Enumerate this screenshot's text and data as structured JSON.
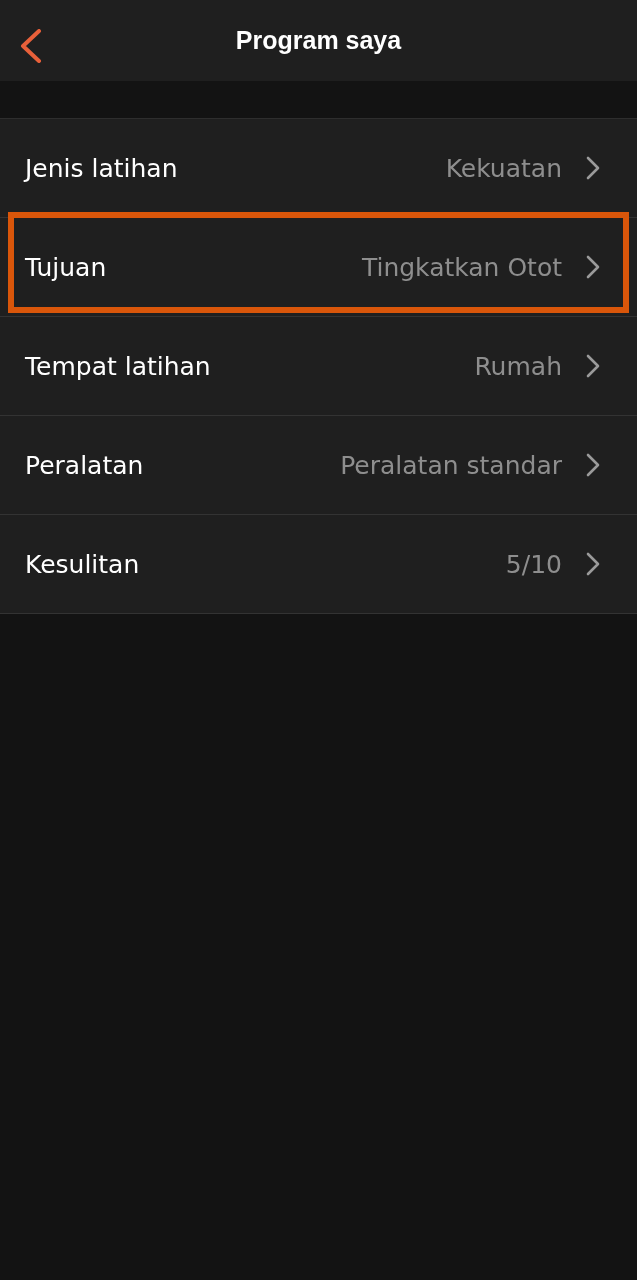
{
  "header": {
    "title": "Program saya"
  },
  "settings": [
    {
      "label": "Jenis latihan",
      "value": "Kekuatan",
      "highlighted": false
    },
    {
      "label": "Tujuan",
      "value": "Tingkatkan Otot",
      "highlighted": true
    },
    {
      "label": "Tempat latihan",
      "value": "Rumah",
      "highlighted": false
    },
    {
      "label": "Peralatan",
      "value": "Peralatan standar",
      "highlighted": false
    },
    {
      "label": "Kesulitan",
      "value": "5/10",
      "highlighted": false
    }
  ]
}
